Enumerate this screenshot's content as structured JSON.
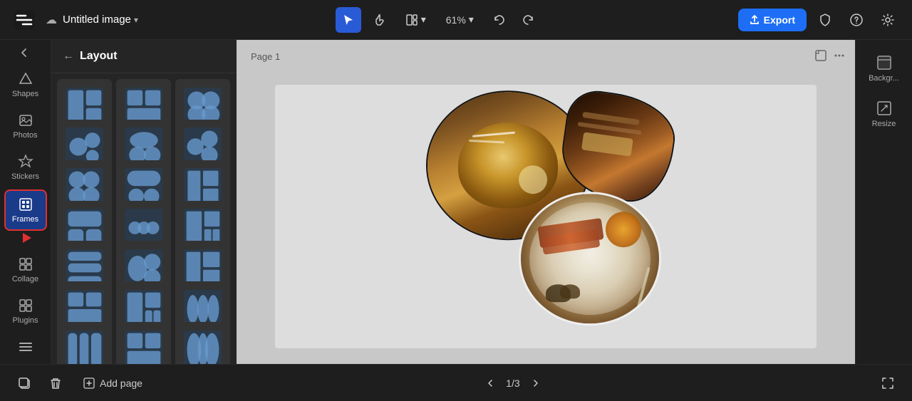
{
  "topbar": {
    "title": "Untitled image",
    "title_chevron": "▾",
    "save_icon": "☁",
    "zoom_level": "61%",
    "export_label": "Export",
    "export_icon": "⬆"
  },
  "sidebar": {
    "items": [
      {
        "id": "shapes",
        "label": "Shapes",
        "icon": "⬡"
      },
      {
        "id": "photos",
        "label": "Photos",
        "icon": "🖼"
      },
      {
        "id": "stickers",
        "label": "Stickers",
        "icon": "✦"
      },
      {
        "id": "frames",
        "label": "Frames",
        "icon": "⊞",
        "active": true
      },
      {
        "id": "collage",
        "label": "Collage",
        "icon": "⊟"
      },
      {
        "id": "plugins",
        "label": "Plugins",
        "icon": "⊞"
      }
    ]
  },
  "panel": {
    "title": "Layout",
    "back_label": "←"
  },
  "canvas": {
    "page_label": "Page 1"
  },
  "bottom": {
    "add_page_label": "Add page",
    "page_current": "1",
    "page_total": "3",
    "page_separator": "/"
  },
  "right_panel": {
    "items": [
      {
        "id": "background",
        "label": "Backgr...",
        "icon": "🖼"
      },
      {
        "id": "resize",
        "label": "Resize",
        "icon": "⊡"
      }
    ]
  },
  "frame_thumbs": [
    "t1",
    "t2",
    "t3",
    "t4",
    "t5",
    "t6",
    "t7",
    "t8",
    "t9",
    "t10",
    "t11",
    "t12",
    "t13",
    "t14",
    "t15",
    "t16",
    "t17",
    "t18",
    "t19",
    "t20",
    "t21",
    "t22",
    "t23",
    "t24"
  ]
}
